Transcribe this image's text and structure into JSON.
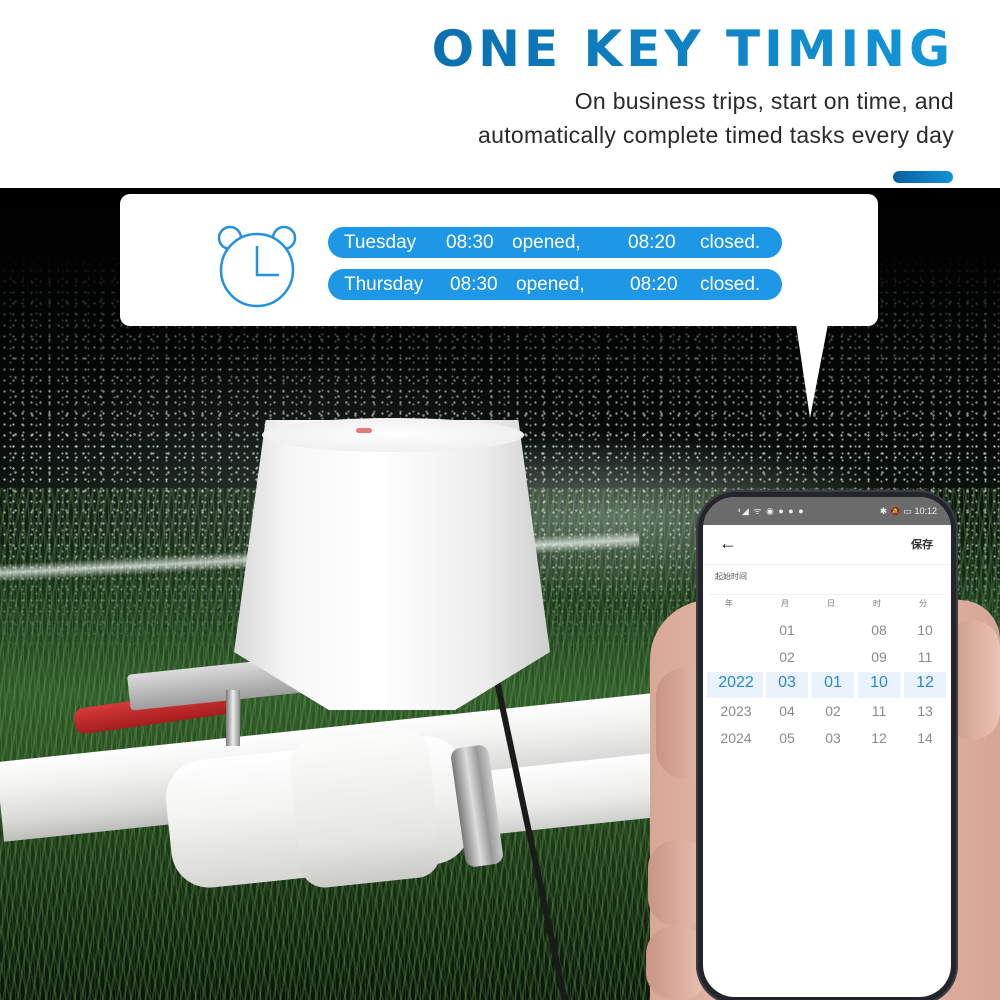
{
  "header": {
    "title": "ONE KEY TIMING",
    "subtitle_line1": "On business trips, start on time, and",
    "subtitle_line2": "automatically complete timed tasks every day",
    "accent_color": "#0d80c4"
  },
  "schedule_bubble": {
    "icon": "alarm-clock-icon",
    "pill_color": "#1e97e6",
    "entries": [
      {
        "day": "Tuesday",
        "open_time": "08:30",
        "open_label": "opened,",
        "close_time": "08:20",
        "close_label": "closed."
      },
      {
        "day": "Thursday",
        "open_time": "08:30",
        "open_label": "opened,",
        "close_time": "08:20",
        "close_label": "closed."
      }
    ]
  },
  "phone": {
    "status_bar": {
      "left_icons": "signal wifi notifications",
      "left_glyphs": "⁴◢ ᯤ ◉ ● ● ●",
      "right_glyphs": "✱ 🔕 ▭",
      "time": "10:12"
    },
    "app_bar": {
      "back_icon": "←",
      "save_label": "保存"
    },
    "section_label": "起始时间",
    "columns": [
      {
        "header": "年",
        "values": [
          "",
          "",
          "2022",
          "2023",
          "2024"
        ]
      },
      {
        "header": "月",
        "values": [
          "01",
          "02",
          "03",
          "04",
          "05"
        ]
      },
      {
        "header": "日",
        "values": [
          "",
          "",
          "01",
          "02",
          "03"
        ]
      },
      {
        "header": "时",
        "values": [
          "08",
          "09",
          "10",
          "11",
          "12"
        ]
      },
      {
        "header": "分",
        "values": [
          "10",
          "11",
          "12",
          "13",
          "14"
        ]
      }
    ],
    "selected": {
      "year": "2022",
      "month": "03",
      "day": "01",
      "hour": "10",
      "minute": "12"
    },
    "selected_color": "#2b88cf"
  }
}
